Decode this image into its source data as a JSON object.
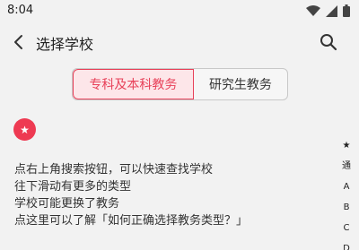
{
  "status_bar": {
    "time": "8:04"
  },
  "app_bar": {
    "title": "选择学校"
  },
  "tabs": [
    {
      "label": "专科及本科教务",
      "active": true
    },
    {
      "label": "研究生教务",
      "active": false
    }
  ],
  "favorites": {
    "icon": "star-icon",
    "color": "#ee3a52"
  },
  "tips": [
    "点右上角搜索按钮，可以快速查找学校",
    "往下滑动有更多的类型",
    "学校可能更换了教务",
    "点这里可以了解「如何正确选择教务类型？」"
  ],
  "index_bar": [
    "★",
    "通",
    "A",
    "B",
    "C",
    "D"
  ],
  "colors": {
    "accent": "#e8425a",
    "accent_bg": "#fde6e9",
    "background": "#f2f2f2"
  }
}
